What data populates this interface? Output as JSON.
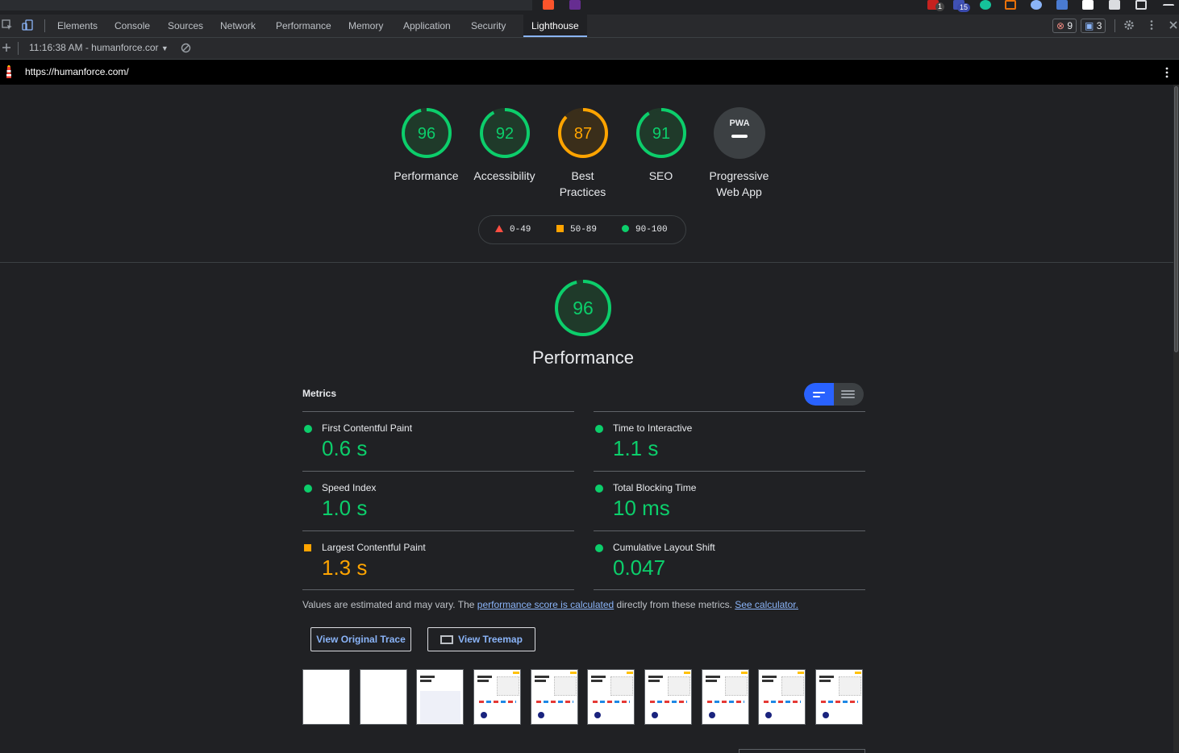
{
  "browser": {
    "ext_badges": [
      "1",
      "15"
    ]
  },
  "devtools": {
    "tabs": [
      "Elements",
      "Console",
      "Sources",
      "Network",
      "Performance",
      "Memory",
      "Application",
      "Security",
      "Lighthouse"
    ],
    "active_tab": "Lighthouse",
    "errors_count": "9",
    "messages_count": "3",
    "report_select": "11:16:38 AM - humanforce.cor"
  },
  "urlbar": {
    "url": "https://humanforce.com/"
  },
  "categories": [
    {
      "score": "96",
      "label_line1": "Performance",
      "label_line2": "",
      "color": "#0cce6b",
      "fraction": 0.96
    },
    {
      "score": "92",
      "label_line1": "Accessibility",
      "label_line2": "",
      "color": "#0cce6b",
      "fraction": 0.92
    },
    {
      "score": "87",
      "label_line1": "Best",
      "label_line2": "Practices",
      "color": "#ffa400",
      "fraction": 0.87
    },
    {
      "score": "91",
      "label_line1": "SEO",
      "label_line2": "",
      "color": "#0cce6b",
      "fraction": 0.91
    },
    {
      "score": "PWA",
      "label_line1": "Progressive",
      "label_line2": "Web App",
      "color": "#9aa0a6",
      "fraction": 0
    }
  ],
  "legend": {
    "fail": "0-49",
    "average": "50-89",
    "pass": "90-100"
  },
  "performance": {
    "score": "96",
    "title": "Performance",
    "metrics_heading": "Metrics",
    "metrics": [
      {
        "name": "First Contentful Paint",
        "value": "0.6 s",
        "status": "pass"
      },
      {
        "name": "Time to Interactive",
        "value": "1.1 s",
        "status": "pass"
      },
      {
        "name": "Speed Index",
        "value": "1.0 s",
        "status": "pass"
      },
      {
        "name": "Total Blocking Time",
        "value": "10 ms",
        "status": "pass"
      },
      {
        "name": "Largest Contentful Paint",
        "value": "1.3 s",
        "status": "average"
      },
      {
        "name": "Cumulative Layout Shift",
        "value": "0.047",
        "status": "pass"
      }
    ],
    "note_prefix": "Values are estimated and may vary. The ",
    "note_link1": "performance score is calculated",
    "note_middle": " directly from these metrics. ",
    "note_link2": "See calculator.",
    "btn_trace": "View Original Trace",
    "btn_treemap": "View Treemap"
  },
  "colors": {
    "pass": "#0cce6b",
    "average": "#ffa400",
    "fail": "#ff4e42"
  }
}
